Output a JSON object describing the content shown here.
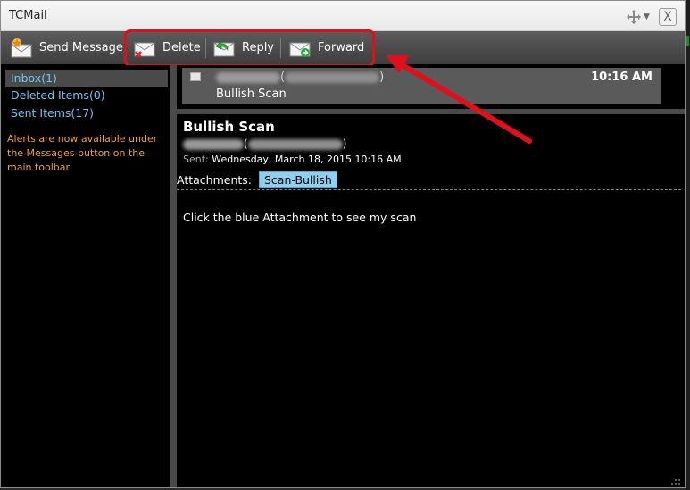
{
  "window": {
    "title": "TCMail",
    "close_label": "X"
  },
  "toolbar": {
    "send_label": "Send Message",
    "delete_label": "Delete",
    "reply_label": "Reply",
    "forward_label": "Forward"
  },
  "sidebar": {
    "items": [
      {
        "label": "Inbox(1)"
      },
      {
        "label": "Deleted Items(0)"
      },
      {
        "label": "Sent Items(17)"
      }
    ],
    "alert_text": "Alerts are now available under the Messages button on the main toolbar"
  },
  "message_list": {
    "rows": [
      {
        "from_open": "(",
        "from_close": ")",
        "time": "10:16 AM",
        "subject": "Bullish Scan"
      }
    ]
  },
  "preview": {
    "subject": "Bullish Scan",
    "from_open": "(",
    "from_close": ")",
    "sent_label": "Sent:",
    "sent_value": "Wednesday, March 18, 2015 10:16 AM",
    "attachments_label": "Attachments:",
    "attachment_name": "Scan-Bullish",
    "body": "Click the blue Attachment to see my scan"
  },
  "colors": {
    "highlight": "#e0101a",
    "link": "#6ec6f0",
    "alert": "#f3a12c",
    "attachment_chip": "#8fd0ef"
  },
  "icons": [
    "send-message-icon",
    "delete-icon",
    "reply-icon",
    "forward-icon",
    "move-icon",
    "pin-icon",
    "close-icon",
    "envelope-icon"
  ]
}
